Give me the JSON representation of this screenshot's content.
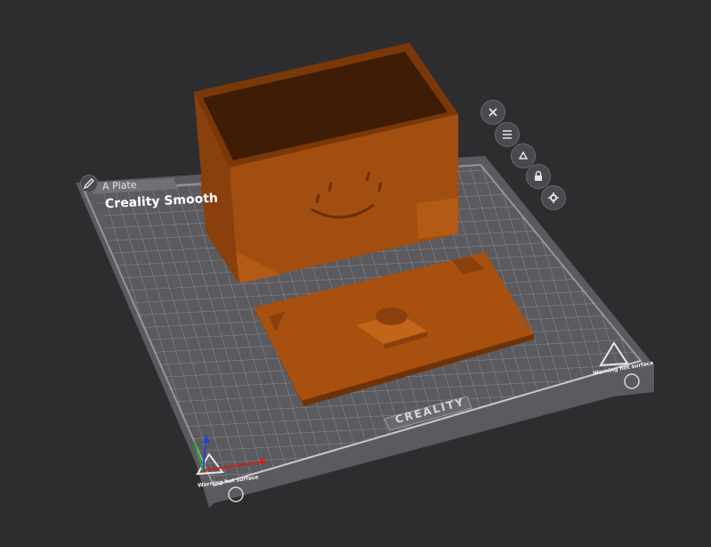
{
  "plate": {
    "tab_label": "A Plate",
    "name_label": "Creality Smooth",
    "brand_logo": "CREALITY",
    "warning_text": "Warning hot surface"
  },
  "toolbar": {
    "buttons": [
      {
        "name": "delete-plate-button",
        "icon": "close-icon"
      },
      {
        "name": "arrange-button",
        "icon": "arrange-icon"
      },
      {
        "name": "orient-button",
        "icon": "orient-icon"
      },
      {
        "name": "lock-button",
        "icon": "lock-icon"
      },
      {
        "name": "settings-button",
        "icon": "gear-icon"
      }
    ]
  },
  "colors": {
    "background": "#2d2d2f",
    "bed": "#5a5a5e",
    "grid": "#8a8a8e",
    "model": "#a8500f",
    "model_dark": "#6e3208",
    "model_light": "#c46418",
    "axis_x": "#cc2222",
    "axis_y": "#22aa22",
    "axis_z": "#2244cc"
  }
}
